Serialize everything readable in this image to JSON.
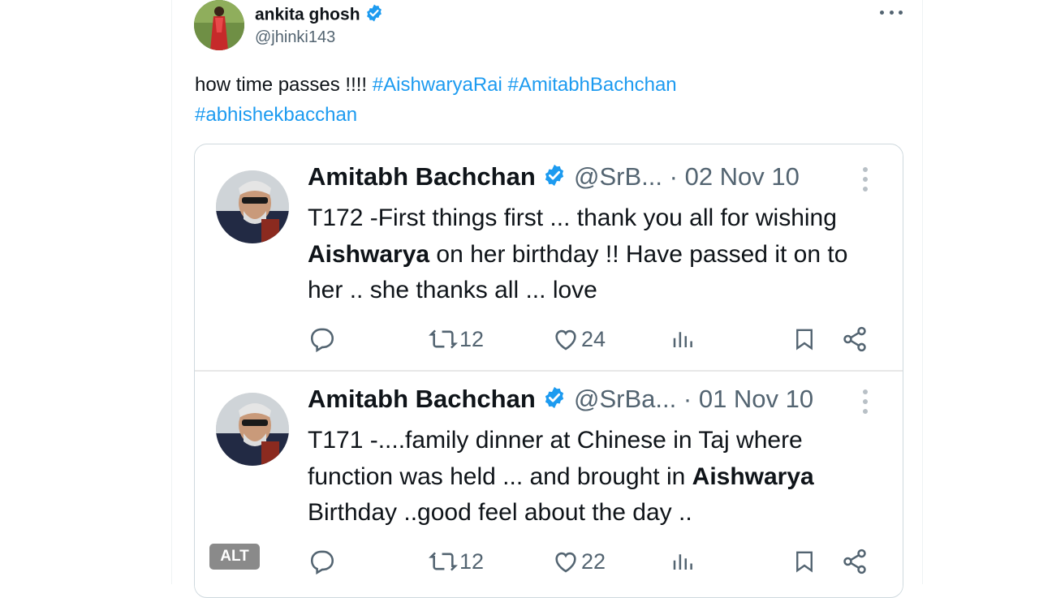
{
  "post": {
    "author_name": "ankita ghosh",
    "author_handle": "@jhinki143",
    "text": "how time passes !!!! ",
    "hashtags": [
      "#AishwaryaRai",
      "#AmitabhBachchan",
      "#abhishekbacchan"
    ],
    "more_icon": "more-horizontal-icon",
    "verified_icon": "verified-badge-icon"
  },
  "media": {
    "alt_label": "ALT",
    "tweets": [
      {
        "name": "Amitabh Bachchan",
        "handle": "@SrB...",
        "date": "· 02 Nov 10",
        "text_before": "T172 -First things first ... thank you all for wishing ",
        "text_bold": "Aishwarya",
        "text_after": " on her birthday !! Have passed it on to her .. she thanks all ... love",
        "retweets": "12",
        "likes": "24"
      },
      {
        "name": "Amitabh Bachchan",
        "handle": "@SrBa...",
        "date": "· 01 Nov 10",
        "text_before": "T171 -....family dinner at Chinese in Taj where function was held ... and brought in ",
        "text_bold": "Aishwarya",
        "text_after": " Birthday ..good feel about the day ..",
        "retweets": "12",
        "likes": "22"
      }
    ]
  },
  "colors": {
    "link": "#1d9bf0",
    "secondary_text": "#536471",
    "verified": "#1d9bf0"
  }
}
